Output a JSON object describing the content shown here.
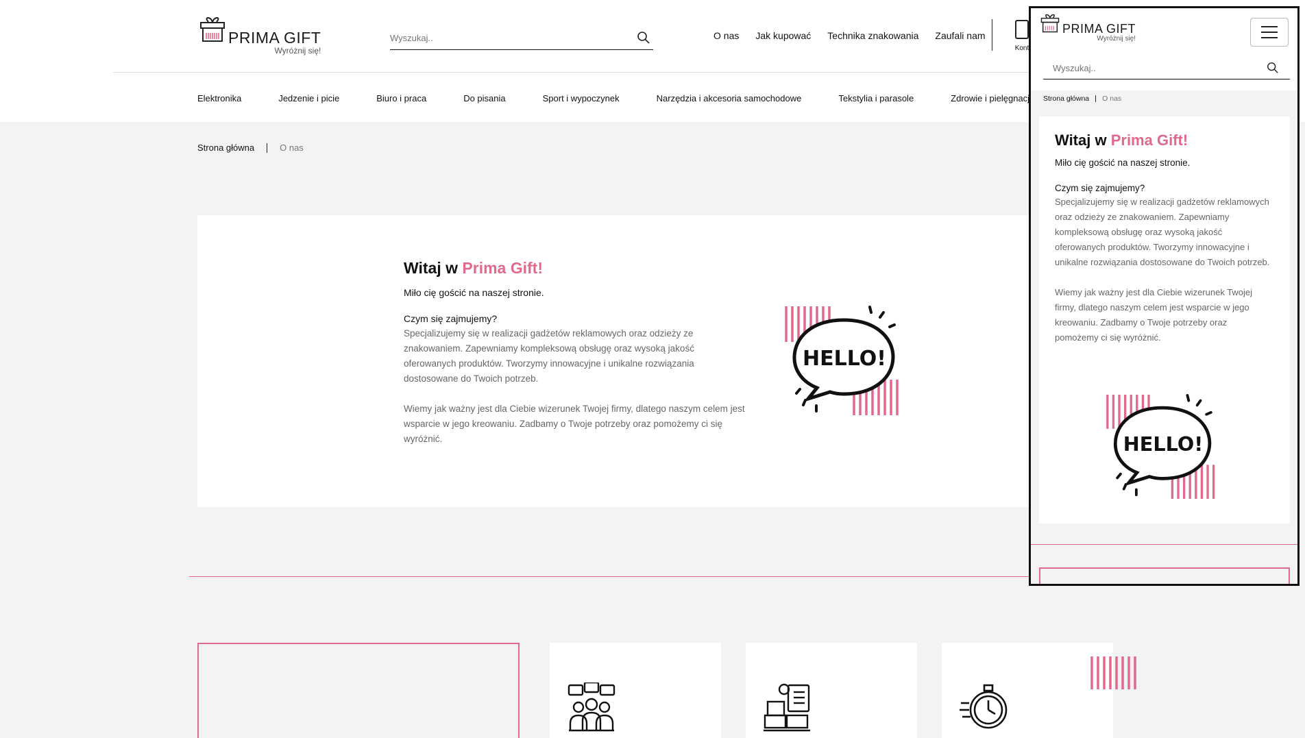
{
  "brand": {
    "name": "PRIMA GIFT",
    "tagline": "Wyróżnij się!"
  },
  "search": {
    "placeholder": "Wyszukaj.."
  },
  "top_nav": [
    "O nas",
    "Jak kupować",
    "Technika znakowania",
    "Zaufali nam"
  ],
  "contact": {
    "label": "Kont"
  },
  "categories": [
    "Elektronika",
    "Jedzenie i picie",
    "Biuro i praca",
    "Do pisania",
    "Sport i wypoczynek",
    "Narzędzia i akcesoria samochodowe",
    "Tekstylia i parasole",
    "Zdrowie i pielęgnacja"
  ],
  "breadcrumb": {
    "home": "Strona główna",
    "current": "O nas"
  },
  "welcome": {
    "title_prefix": "Witaj w ",
    "title_brand": "Prima Gift!",
    "lead": "Miło cię gościć na naszej stronie.",
    "question": "Czym się zajmujemy?",
    "paragraph1": "Specjalizujemy się w realizacji gadżetów reklamowych oraz odzieży ze znakowaniem. Zapewniamy kompleksową obsługę oraz wysoką jakość oferowanych produktów. Tworzymy innowacyjne i unikalne rozwiązania dostosowane do Twoich potrzeb.",
    "paragraph2": "Wiemy jak ważny jest dla Ciebie wizerunek Twojej firmy, dlatego naszym celem jest wsparcie w jego kreowaniu. Zadbamy o Twoje potrzeby oraz pomożemy ci się wyróżnić.",
    "illustration_text": "HELLO!"
  },
  "colors": {
    "accent": "#e0698c",
    "background": "#f3f3f3",
    "text": "#111111",
    "muted": "#666666"
  },
  "icons": [
    "search-icon",
    "gift-icon",
    "contact-icon",
    "menu-icon",
    "community-icon",
    "logistics-icon",
    "stopwatch-icon"
  ]
}
